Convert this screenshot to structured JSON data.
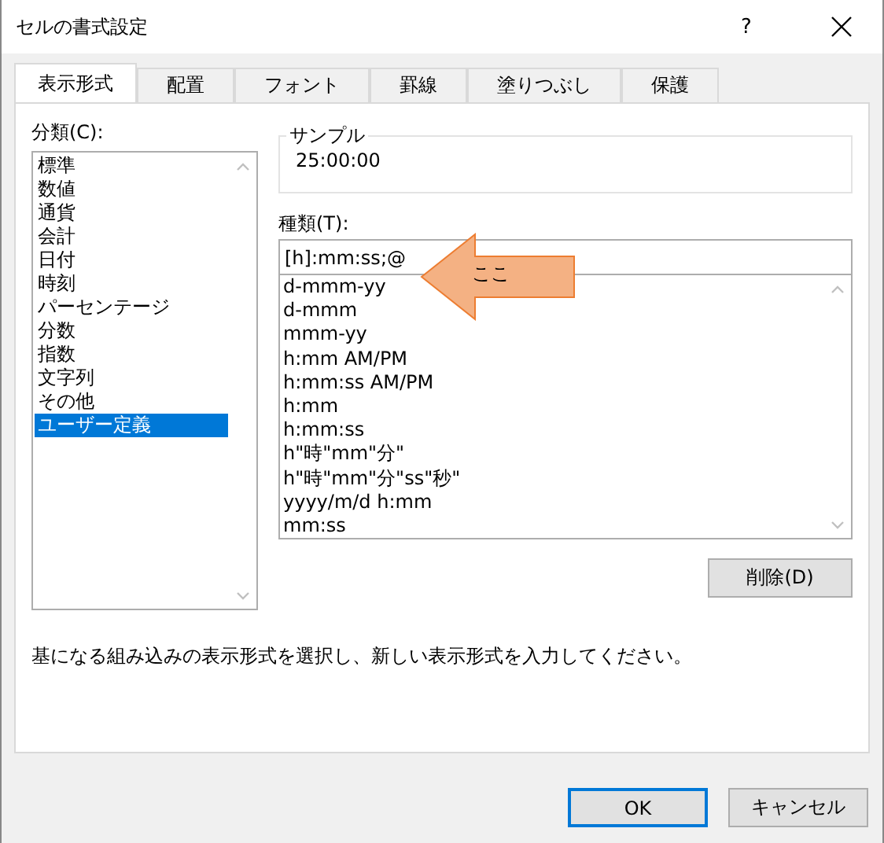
{
  "window": {
    "title": "セルの書式設定",
    "help": "?"
  },
  "tabs": [
    {
      "label": "表示形式",
      "selected": true
    },
    {
      "label": "配置",
      "selected": false
    },
    {
      "label": "フォント",
      "selected": false
    },
    {
      "label": "罫線",
      "selected": false
    },
    {
      "label": "塗りつぶし",
      "selected": false
    },
    {
      "label": "保護",
      "selected": false
    }
  ],
  "category": {
    "label": "分類(C):",
    "items": [
      {
        "label": "標準",
        "selected": false
      },
      {
        "label": "数値",
        "selected": false
      },
      {
        "label": "通貨",
        "selected": false
      },
      {
        "label": "会計",
        "selected": false
      },
      {
        "label": "日付",
        "selected": false
      },
      {
        "label": "時刻",
        "selected": false
      },
      {
        "label": "パーセンテージ",
        "selected": false
      },
      {
        "label": "分数",
        "selected": false
      },
      {
        "label": "指数",
        "selected": false
      },
      {
        "label": "文字列",
        "selected": false
      },
      {
        "label": "その他",
        "selected": false
      },
      {
        "label": "ユーザー定義",
        "selected": true
      }
    ]
  },
  "sample": {
    "label": "サンプル",
    "value": "25:00:00"
  },
  "type": {
    "label": "種類(T):",
    "value": "[h]:mm:ss;@",
    "formats": [
      "d-mmm-yy",
      "d-mmm",
      "mmm-yy",
      "h:mm AM/PM",
      "h:mm:ss AM/PM",
      "h:mm",
      "h:mm:ss",
      "h\"時\"mm\"分\"",
      "h\"時\"mm\"分\"ss\"秒\"",
      "yyyy/m/d h:mm",
      "mm:ss"
    ]
  },
  "delete_button": "削除(D)",
  "annotation": {
    "text": "ここ"
  },
  "description": "基になる組み込みの表示形式を選択し、新しい表示形式を入力してください。",
  "buttons": [
    {
      "label": "OK",
      "default": true
    },
    {
      "label": "キャンセル",
      "default": false
    }
  ]
}
